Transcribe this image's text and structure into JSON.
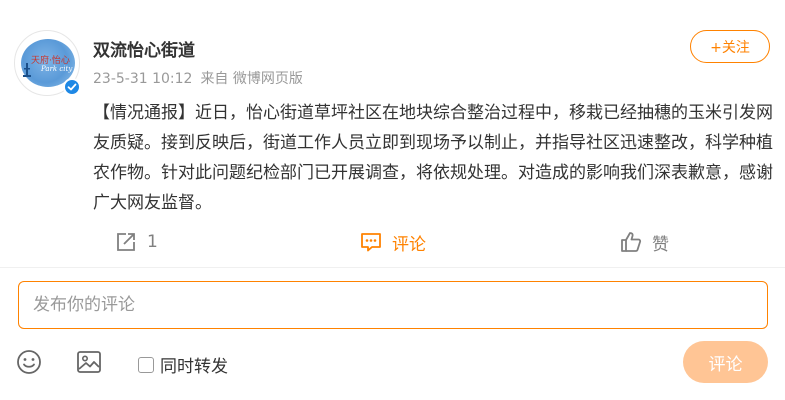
{
  "post": {
    "author": "双流怡心街道",
    "avatar": {
      "logo_cn": "天府·怡心",
      "logo_en": "Park city"
    },
    "time": "23-5-31 10:12",
    "source": "来自 微博网页版",
    "follow_label": "+关注",
    "content": "【情况通报】近日，怡心街道草坪社区在地块综合整治过程中，移栽已经抽穗的玉米引发网友质疑。接到反映后，街道工作人员立即到现场予以制止，并指导社区迅速整改，科学种植农作物。针对此问题纪检部门已开展调查，将依规处理。对造成的影响我们深表歉意，感谢广大网友监督。"
  },
  "actions": {
    "repost_count": "1",
    "comment_label": "评论",
    "like_label": "赞"
  },
  "composer": {
    "placeholder": "发布你的评论",
    "repost_label": "同时转发",
    "submit_label": "评论"
  },
  "colors": {
    "accent": "#ff8200",
    "submit_disabled": "#ffc595",
    "verified": "#1e88e5"
  },
  "icons": {
    "repost": "share-icon",
    "comment": "comment-icon",
    "like": "thumbs-up-icon",
    "emoji": "emoji-icon",
    "image": "image-icon",
    "verified": "verified-badge-icon"
  }
}
